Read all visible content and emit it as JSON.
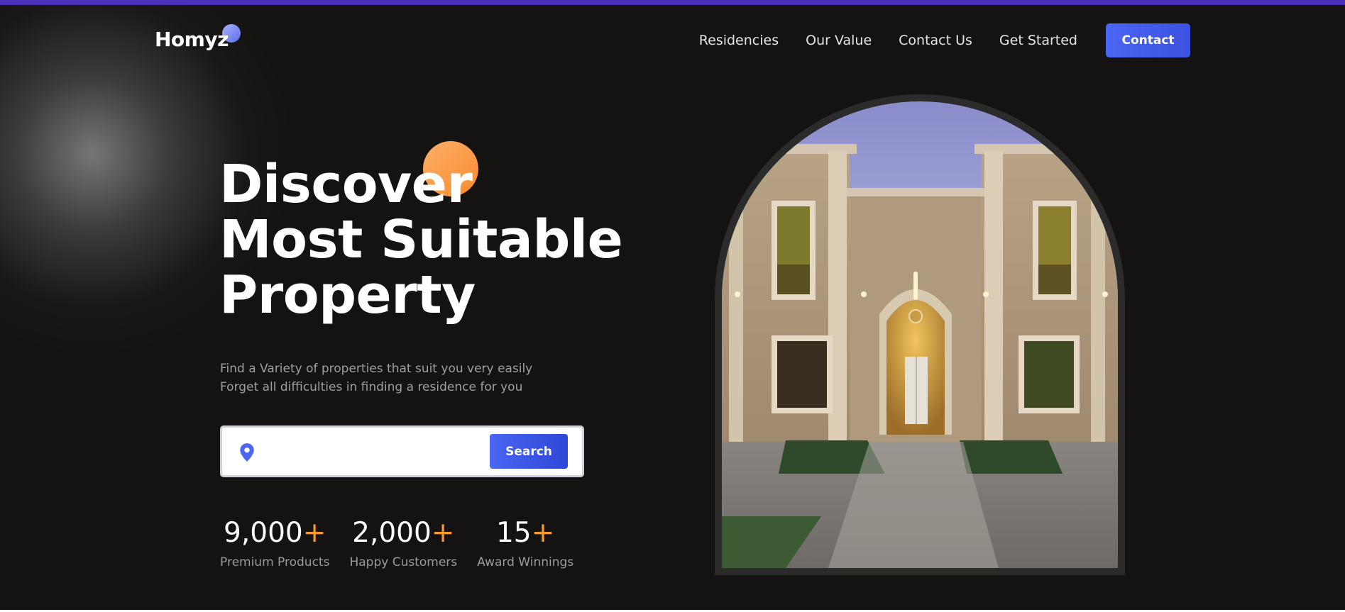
{
  "colors": {
    "accent_blue": "#4a66f3",
    "accent_orange": "#f99a2c",
    "background": "#151312",
    "top_bar": "#4a31b8"
  },
  "header": {
    "logo": "Homyz",
    "nav": [
      "Residencies",
      "Our Value",
      "Contact Us",
      "Get Started"
    ],
    "cta_label": "Contact"
  },
  "hero": {
    "title_lines": [
      "Discover",
      "Most Suitable",
      "Property"
    ],
    "subtitle_lines": [
      "Find a Variety of properties that suit you very easily",
      "Forget all difficulties in finding a residence for you"
    ],
    "search": {
      "icon": "location-pin-icon",
      "placeholder": "",
      "value": "",
      "button_label": "Search"
    },
    "stats": [
      {
        "number": "9,000",
        "suffix": "+",
        "label": "Premium Products"
      },
      {
        "number": "2,000",
        "suffix": "+",
        "label": "Happy Customers"
      },
      {
        "number": "15",
        "suffix": "+",
        "label": "Award Winnings"
      }
    ],
    "image": {
      "subject": "villa-night-photo"
    }
  }
}
